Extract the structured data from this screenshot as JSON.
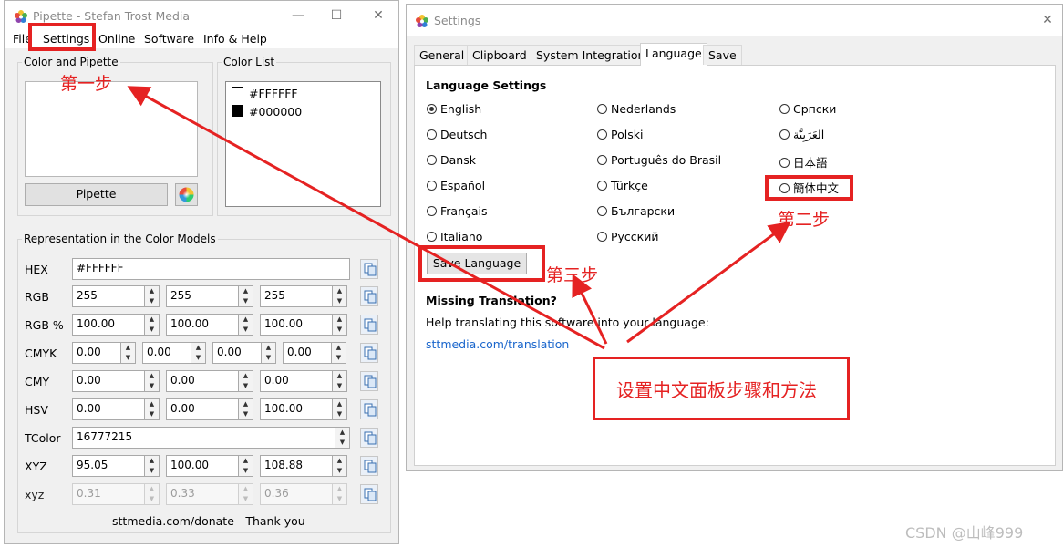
{
  "pipette": {
    "title": "Pipette - Stefan Trost Media",
    "menu": [
      "File",
      "Settings",
      "Online",
      "Software",
      "Info & Help"
    ],
    "color_group_label": "Color and Pipette",
    "color_list_label": "Color List",
    "color_list": [
      {
        "hex": "#FFFFFF",
        "swatch": "#ffffff"
      },
      {
        "hex": "#000000",
        "swatch": "#000000"
      }
    ],
    "pipette_button": "Pipette",
    "models_label": "Representation in the Color Models",
    "rows": {
      "hex": {
        "label": "HEX",
        "value": "#FFFFFF"
      },
      "rgb": {
        "label": "RGB",
        "values": [
          "255",
          "255",
          "255"
        ]
      },
      "rgbp": {
        "label": "RGB %",
        "values": [
          "100.00",
          "100.00",
          "100.00"
        ]
      },
      "cmyk": {
        "label": "CMYK",
        "values": [
          "0.00",
          "0.00",
          "0.00",
          "0.00"
        ]
      },
      "cmy": {
        "label": "CMY",
        "values": [
          "0.00",
          "0.00",
          "0.00"
        ]
      },
      "hsv": {
        "label": "HSV",
        "values": [
          "0.00",
          "0.00",
          "100.00"
        ]
      },
      "tcolor": {
        "label": "TColor",
        "value": "16777215"
      },
      "xyz": {
        "label": "XYZ",
        "values": [
          "95.05",
          "100.00",
          "108.88"
        ]
      },
      "xyz2": {
        "label": "xyz",
        "values": [
          "0.31",
          "0.33",
          "0.36"
        ]
      }
    },
    "footer": "sttmedia.com/donate - Thank you"
  },
  "settings": {
    "title": "Settings",
    "tabs": [
      "General",
      "Clipboard",
      "System Integration",
      "Language",
      "Save"
    ],
    "active_tab": "Language",
    "heading": "Language Settings",
    "languages": {
      "col1": [
        "English",
        "Deutsch",
        "Dansk",
        "Español",
        "Français",
        "Italiano"
      ],
      "col2": [
        "Nederlands",
        "Polski",
        "Português do Brasil",
        "Türkçe",
        "Български",
        "Русский"
      ],
      "col3": [
        "Српски",
        "العَرَبِيَّة",
        "日本語",
        "簡体中文"
      ]
    },
    "selected_language": "English",
    "save_button": "Save Language",
    "missing_heading": "Missing Translation?",
    "missing_text": "Help translating this software into your language:",
    "missing_link": "sttmedia.com/translation"
  },
  "annotations": {
    "step1": "第一步",
    "step2": "第二步",
    "step3": "第三步",
    "caption": "设置中文面板步骤和方法"
  },
  "watermark": "CSDN @山峰999",
  "colors": {
    "annotation_red": "#e52222",
    "link_blue": "#1a66cc"
  }
}
